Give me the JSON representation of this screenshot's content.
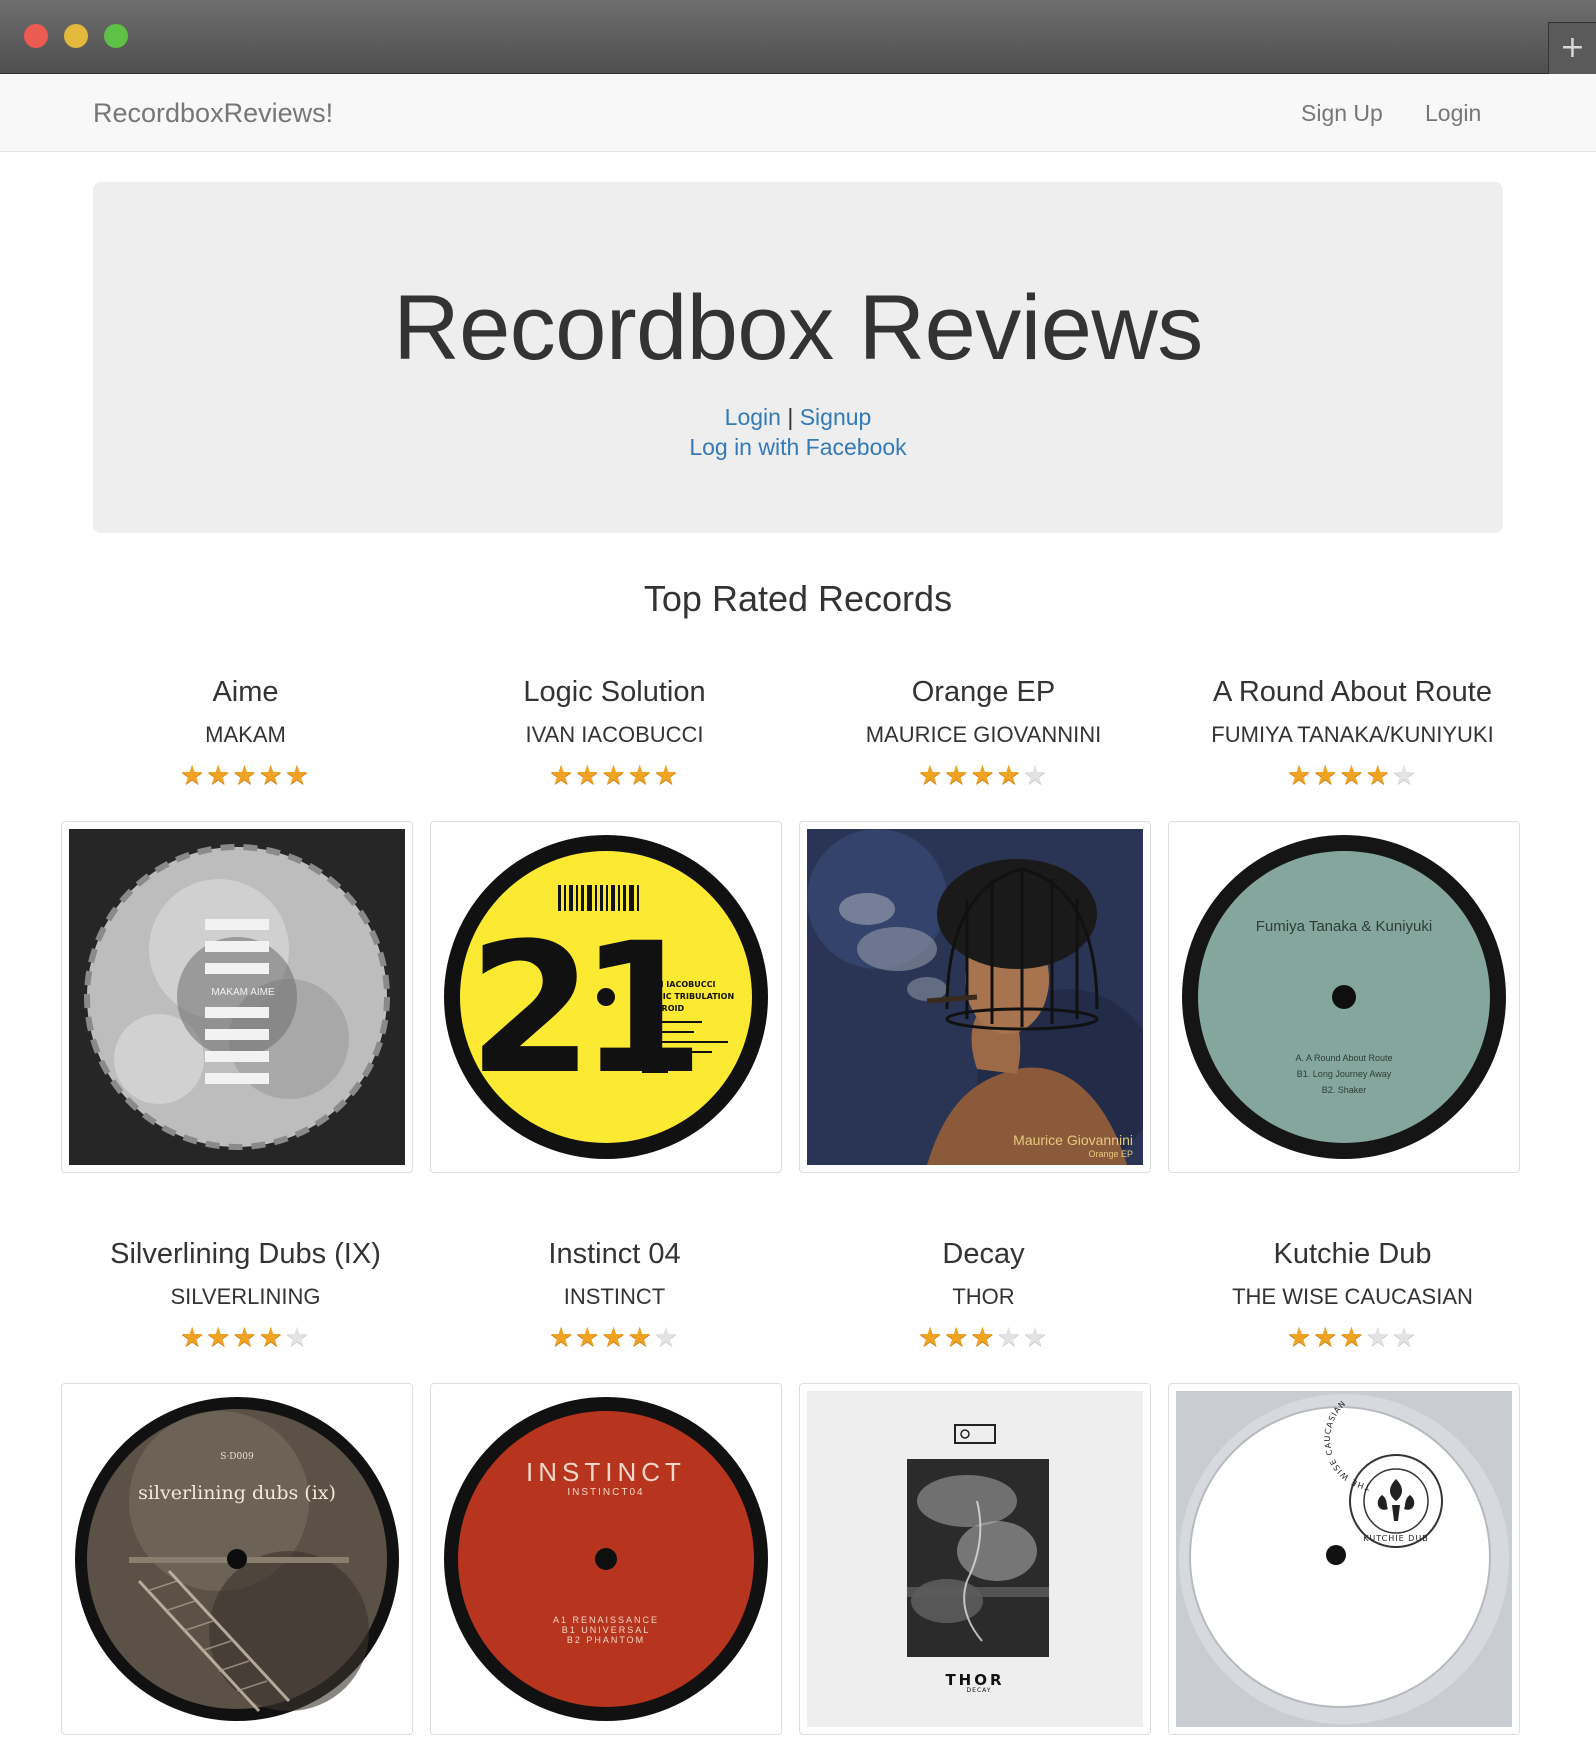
{
  "nav": {
    "brand": "RecordboxReviews!",
    "signup": "Sign Up",
    "login": "Login"
  },
  "jumbotron": {
    "title": "Recordbox Reviews",
    "login_link": "Login",
    "separator": "|",
    "signup_link": "Signup",
    "facebook_link": "Log in with Facebook"
  },
  "section_title": "Top Rated Records",
  "records": [
    {
      "title": "Aime",
      "artist": "MAKAM",
      "rating": 5,
      "max_rating": 5,
      "cover": {
        "style": "bw-circle",
        "text": "MAKAM AIME"
      }
    },
    {
      "title": "Logic Solution",
      "artist": "IVAN IACOBUCCI",
      "rating": 5,
      "max_rating": 5,
      "cover": {
        "style": "yellow-label",
        "number": "21",
        "lines": [
          "IVAN IACOBUCCI",
          "MAGIC TRIBULATION",
          "ANDROID"
        ]
      }
    },
    {
      "title": "Orange EP",
      "artist": "MAURICE GIOVANNINI",
      "rating": 4,
      "max_rating": 5,
      "cover": {
        "style": "painting",
        "artist_text": "Maurice Giovannini",
        "title_text": "Orange EP"
      }
    },
    {
      "title": "A Round About Route",
      "artist": "FUMIYA TANAKA/KUNIYUKI",
      "rating": 4,
      "max_rating": 5,
      "cover": {
        "style": "green-label",
        "header": "Fumiya Tanaka & Kuniyuki",
        "lines": [
          "A. A Round About Route",
          "B1. Long Journey Away",
          "B2. Shaker"
        ]
      }
    },
    {
      "title": "Silverlining Dubs (IX)",
      "artist": "SILVERLINING",
      "rating": 4,
      "max_rating": 5,
      "cover": {
        "style": "sepia-label",
        "code": "S·D009",
        "label": "silverlining dubs (ix)"
      }
    },
    {
      "title": "Instinct 04",
      "artist": "INSTINCT",
      "rating": 4,
      "max_rating": 5,
      "cover": {
        "style": "red-label",
        "label": "INSTINCT",
        "code": "INSTINCT04",
        "lines": [
          "A1  RENAISSANCE",
          "B1  UNIVERSAL",
          "B2  PHANTOM"
        ]
      }
    },
    {
      "title": "Decay",
      "artist": "THOR",
      "rating": 3,
      "max_rating": 5,
      "cover": {
        "style": "photo-sleeve",
        "label": "THOR",
        "sub": "DECAY"
      }
    },
    {
      "title": "Kutchie Dub",
      "artist": "THE WISE CAUCASIAN",
      "rating": 3,
      "max_rating": 5,
      "cover": {
        "style": "white-label",
        "ring_top": "THE WISE CAUCASIAN",
        "ring_bottom": "KUTCHIE DUB"
      }
    }
  ]
}
